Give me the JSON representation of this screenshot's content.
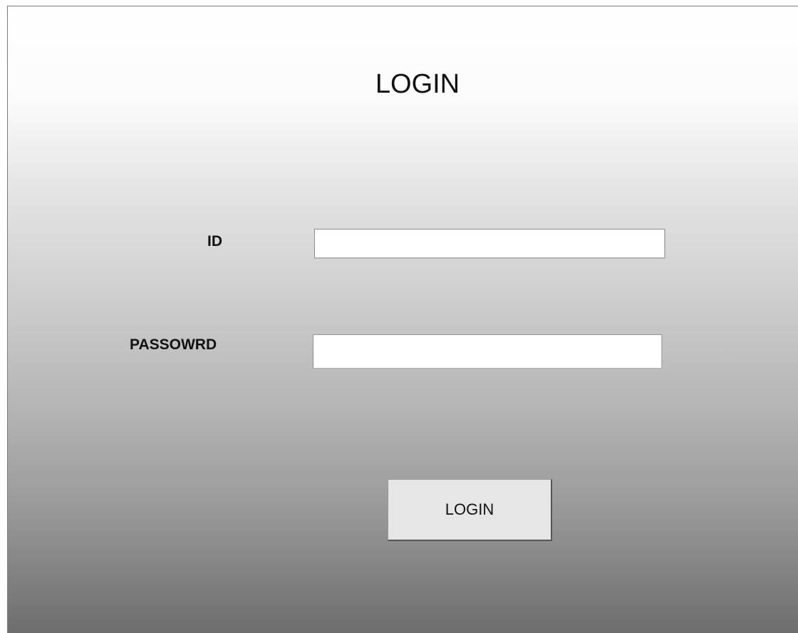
{
  "title": "LOGIN",
  "form": {
    "id_label": "ID",
    "id_value": "",
    "password_label": "PASSOWRD",
    "password_value": ""
  },
  "button": {
    "login_label": "LOGIN"
  }
}
